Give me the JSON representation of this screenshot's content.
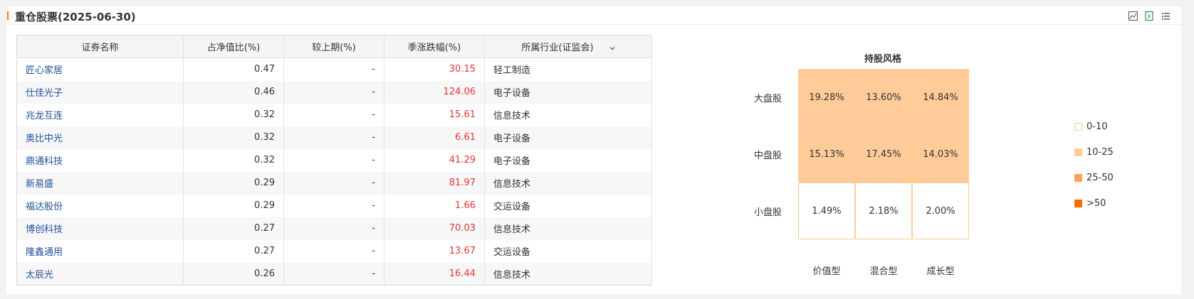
{
  "header": {
    "title": "重仓股票(2025-06-30)"
  },
  "toolbar": {
    "icons": [
      "chart-export-icon",
      "excel-export-icon",
      "list-icon"
    ]
  },
  "table": {
    "columns": [
      "证券名称",
      "占净值比(%)",
      "较上期(%)",
      "季涨跌幅(%)",
      "所属行业(证监会)"
    ],
    "rows": [
      {
        "name": "匠心家居",
        "ratio": "0.47",
        "change": "-",
        "season": "30.15",
        "industry": "轻工制造"
      },
      {
        "name": "仕佳光子",
        "ratio": "0.46",
        "change": "-",
        "season": "124.06",
        "industry": "电子设备"
      },
      {
        "name": "兆龙互连",
        "ratio": "0.32",
        "change": "-",
        "season": "15.61",
        "industry": "信息技术"
      },
      {
        "name": "奥比中光",
        "ratio": "0.32",
        "change": "-",
        "season": "6.61",
        "industry": "电子设备"
      },
      {
        "name": "鼎通科技",
        "ratio": "0.32",
        "change": "-",
        "season": "41.29",
        "industry": "电子设备"
      },
      {
        "name": "新易盛",
        "ratio": "0.29",
        "change": "-",
        "season": "81.97",
        "industry": "信息技术"
      },
      {
        "name": "福达股份",
        "ratio": "0.29",
        "change": "-",
        "season": "1.66",
        "industry": "交运设备"
      },
      {
        "name": "博创科技",
        "ratio": "0.27",
        "change": "-",
        "season": "70.03",
        "industry": "信息技术"
      },
      {
        "name": "隆鑫通用",
        "ratio": "0.27",
        "change": "-",
        "season": "13.67",
        "industry": "交运设备"
      },
      {
        "name": "太辰光",
        "ratio": "0.26",
        "change": "-",
        "season": "16.44",
        "industry": "信息技术"
      }
    ]
  },
  "style_box": {
    "title": "持股风格",
    "rows": [
      "大盘股",
      "中盘股",
      "小盘股"
    ],
    "cols": [
      "价值型",
      "混合型",
      "成长型"
    ],
    "cells": [
      [
        "19.28%",
        "13.60%",
        "14.84%"
      ],
      [
        "15.13%",
        "17.45%",
        "14.03%"
      ],
      [
        "1.49%",
        "2.18%",
        "2.00%"
      ]
    ],
    "levels": [
      [
        1,
        1,
        1
      ],
      [
        1,
        1,
        1
      ],
      [
        0,
        0,
        0
      ]
    ],
    "legend": [
      {
        "label": "0-10",
        "color": "#ffffff"
      },
      {
        "label": "10-25",
        "color": "#ffcc99"
      },
      {
        "label": "25-50",
        "color": "#ff9f55"
      },
      {
        "label": ">50",
        "color": "#ff6a00"
      }
    ]
  },
  "colors": {
    "accent": "#f26d21",
    "link": "#1f4e9c",
    "up": "#e63434"
  }
}
